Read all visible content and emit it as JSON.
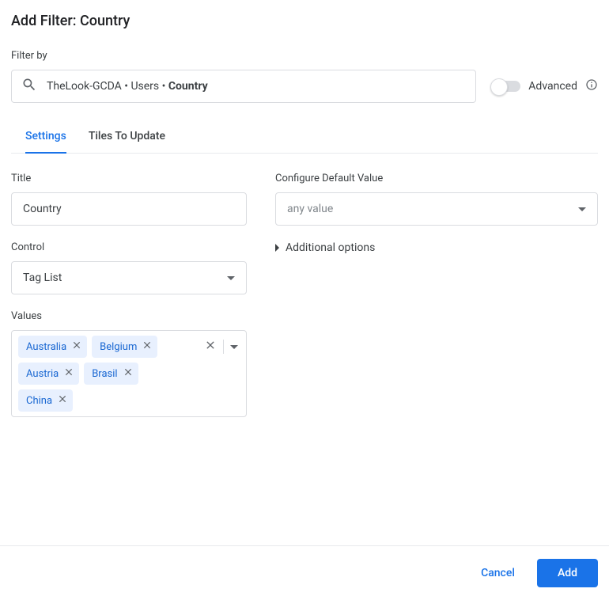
{
  "dialog": {
    "title": "Add Filter: Country"
  },
  "filterBy": {
    "label": "Filter by",
    "breadcrumb_prefix": "TheLook-GCDA • Users • ",
    "breadcrumb_bold": "Country"
  },
  "advanced": {
    "label": "Advanced"
  },
  "tabs": {
    "settings": "Settings",
    "tilesToUpdate": "Tiles To Update"
  },
  "title": {
    "label": "Title",
    "value": "Country"
  },
  "control": {
    "label": "Control",
    "value": "Tag List"
  },
  "values": {
    "label": "Values",
    "tags": [
      "Australia",
      "Belgium",
      "Austria",
      "Brasil",
      "China"
    ]
  },
  "configureDefault": {
    "label": "Configure Default Value",
    "value": "any value"
  },
  "additionalOptions": {
    "label": "Additional options"
  },
  "footer": {
    "cancel": "Cancel",
    "add": "Add"
  }
}
